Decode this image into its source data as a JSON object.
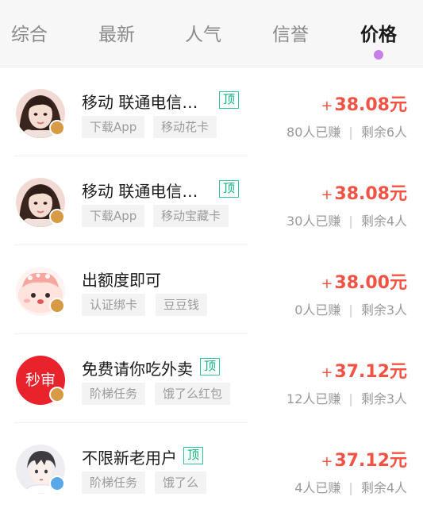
{
  "tabs": [
    {
      "label": "综合",
      "active": false
    },
    {
      "label": "最新",
      "active": false
    },
    {
      "label": "人气",
      "active": false
    },
    {
      "label": "信誉",
      "active": false
    },
    {
      "label": "价格",
      "active": true
    }
  ],
  "colors": {
    "accent": "#c77ee8",
    "price": "#f05243",
    "top_tag": "#1fae82"
  },
  "tasks": [
    {
      "avatar": "girl-photo-avatar",
      "badge": "gold-level-badge",
      "title": "移动 联通电信…",
      "top_tag": "顶",
      "tags": [
        "下载App",
        "移动花卡"
      ],
      "price_sign": "+",
      "price": "38.08元",
      "earned": "80人已赚",
      "divider": "|",
      "remaining": "剩余6人"
    },
    {
      "avatar": "girl-photo-avatar",
      "badge": "gold-level-badge",
      "title": "移动 联通电信…",
      "top_tag": "顶",
      "tags": [
        "下载App",
        "移动宝藏卡"
      ],
      "price_sign": "+",
      "price": "38.08元",
      "earned": "30人已赚",
      "divider": "|",
      "remaining": "剩余4人"
    },
    {
      "avatar": "pink-cartoon-avatar",
      "badge": "gold-level-badge",
      "title": "出额度即可",
      "top_tag": "",
      "tags": [
        "认证绑卡",
        "豆豆钱"
      ],
      "price_sign": "+",
      "price": "38.00元",
      "earned": "0人已赚",
      "divider": "|",
      "remaining": "剩余3人"
    },
    {
      "avatar": "miaoshen-red-avatar",
      "avatar_text": "秒审",
      "badge": "gold-level-badge",
      "title": "免费请你吃外卖",
      "top_tag": "顶",
      "tags": [
        "阶梯任务",
        "饿了么红包"
      ],
      "price_sign": "+",
      "price": "37.12元",
      "earned": "12人已赚",
      "divider": "|",
      "remaining": "剩余3人"
    },
    {
      "avatar": "anime-boy-avatar",
      "badge": "blue-level-badge",
      "title": "不限新老用户",
      "top_tag": "顶",
      "tags": [
        "阶梯任务",
        "饿了么"
      ],
      "price_sign": "+",
      "price": "37.12元",
      "earned": "4人已赚",
      "divider": "|",
      "remaining": "剩余4人"
    }
  ]
}
